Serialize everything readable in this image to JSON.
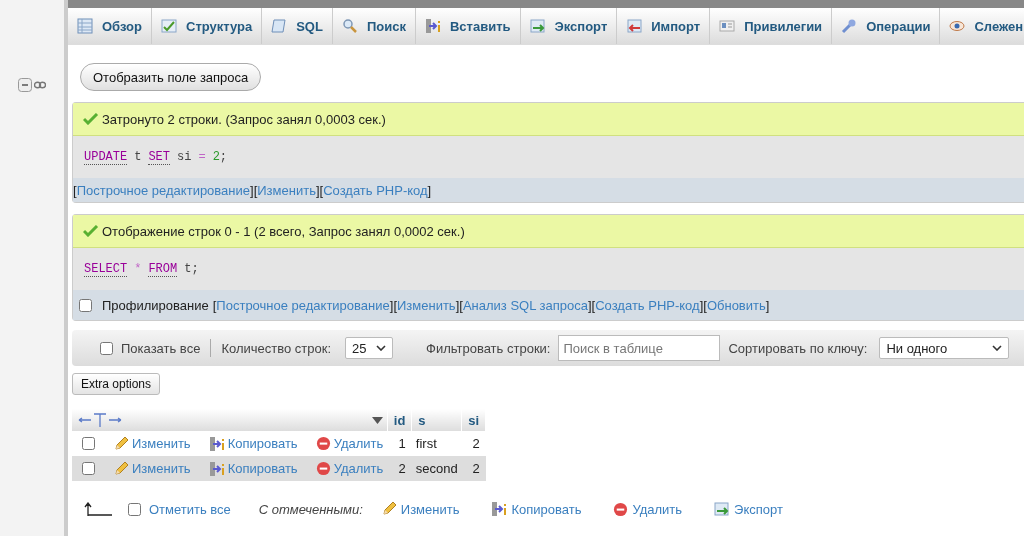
{
  "tabs": [
    {
      "label": "Обзор",
      "kind": "browse",
      "selected": false
    },
    {
      "label": "Структура",
      "kind": "structure",
      "selected": false
    },
    {
      "label": "SQL",
      "kind": "sql",
      "selected": false
    },
    {
      "label": "Поиск",
      "kind": "search",
      "selected": false
    },
    {
      "label": "Вставить",
      "kind": "insert",
      "selected": false
    },
    {
      "label": "Экспорт",
      "kind": "export",
      "selected": false
    },
    {
      "label": "Импорт",
      "kind": "import",
      "selected": false
    },
    {
      "label": "Привилегии",
      "kind": "privileges",
      "selected": false
    },
    {
      "label": "Операции",
      "kind": "operations",
      "selected": false
    },
    {
      "label": "Слежен",
      "kind": "tracking",
      "selected": false
    }
  ],
  "brackets": {
    "open": "[",
    "close": "]"
  },
  "show_query_button": "Отобразить поле запроса",
  "results": [
    {
      "message": "Затронуто 2 строки. (Запрос занял 0,0003 сек.)",
      "sql": [
        {
          "kind": "keyword",
          "text": "UPDATE"
        },
        {
          "kind": "name",
          "text": "t"
        },
        {
          "kind": "keyword",
          "text": "SET"
        },
        {
          "kind": "name",
          "text": "si"
        },
        {
          "kind": "operator",
          "text": "="
        },
        {
          "kind": "number",
          "text": "2"
        },
        {
          "kind": "punct",
          "text": ";"
        }
      ],
      "links": [
        "Построчное редактирование",
        "Изменить",
        "Создать PHP-код"
      ]
    },
    {
      "message": "Отображение строк 0 - 1 (2 всего, Запрос занял 0,0002 сек.)",
      "sql": [
        {
          "kind": "keyword",
          "text": "SELECT"
        },
        {
          "kind": "operator",
          "text": "*"
        },
        {
          "kind": "keyword",
          "text": "FROM"
        },
        {
          "kind": "name",
          "text": "t"
        },
        {
          "kind": "punct",
          "text": ";"
        }
      ],
      "profiling": {
        "label": "Профилирование",
        "checked": false
      },
      "links": [
        "Построчное редактирование",
        "Изменить",
        "Анализ SQL запроса",
        "Создать PHP-код",
        "Обновить"
      ]
    }
  ],
  "navigation": {
    "show_all": {
      "label": "Показать все",
      "checked": false
    },
    "rows_label": "Количество строк:",
    "rows_value": "25",
    "filter_label": "Фильтровать строки:",
    "filter_placeholder": "Поиск в таблице",
    "sort_label": "Сортировать по ключу:",
    "sort_value": "Ни одного"
  },
  "extra_options": "Extra options",
  "table": {
    "columns": [
      "id",
      "s",
      "si"
    ],
    "rows": [
      {
        "checked": false,
        "highlighted": false,
        "actions": [
          {
            "kind": "edit",
            "label": "Изменить"
          },
          {
            "kind": "copy",
            "label": "Копировать"
          },
          {
            "kind": "delete",
            "label": "Удалить"
          }
        ],
        "cells": [
          "1",
          "first",
          "2"
        ]
      },
      {
        "checked": false,
        "highlighted": true,
        "actions": [
          {
            "kind": "edit",
            "label": "Изменить"
          },
          {
            "kind": "copy",
            "label": "Копировать"
          },
          {
            "kind": "delete",
            "label": "Удалить"
          }
        ],
        "cells": [
          "2",
          "second",
          "2"
        ]
      }
    ]
  },
  "bulk": {
    "check_all": {
      "label": "Отметить все",
      "checked": false
    },
    "with_selected": "С отмеченными:",
    "actions": [
      {
        "kind": "edit",
        "label": "Изменить"
      },
      {
        "kind": "copy",
        "label": "Копировать"
      },
      {
        "kind": "delete",
        "label": "Удалить"
      },
      {
        "kind": "export",
        "label": "Экспорт"
      }
    ]
  }
}
